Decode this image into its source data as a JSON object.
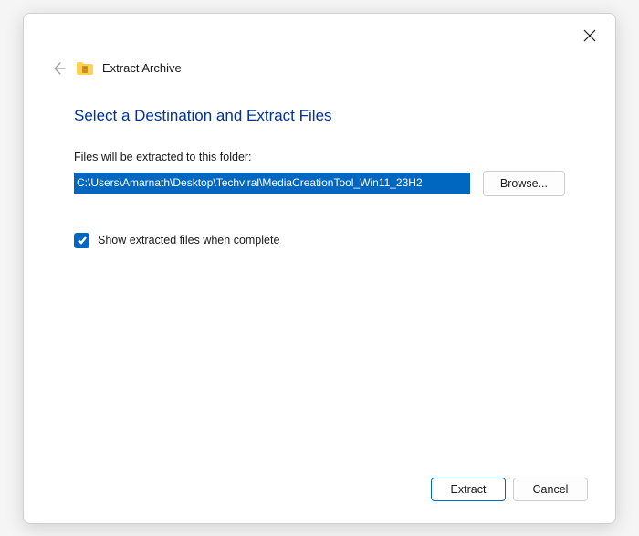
{
  "dialog": {
    "title": "Extract Archive",
    "heading": "Select a Destination and Extract Files",
    "field_label": "Files will be extracted to this folder:",
    "path_value": "C:\\Users\\Amarnath\\Desktop\\Techviral\\MediaCreationTool_Win11_23H2",
    "browse_label": "Browse...",
    "checkbox_label": "Show extracted files when complete",
    "checkbox_checked": true,
    "extract_label": "Extract",
    "cancel_label": "Cancel"
  }
}
